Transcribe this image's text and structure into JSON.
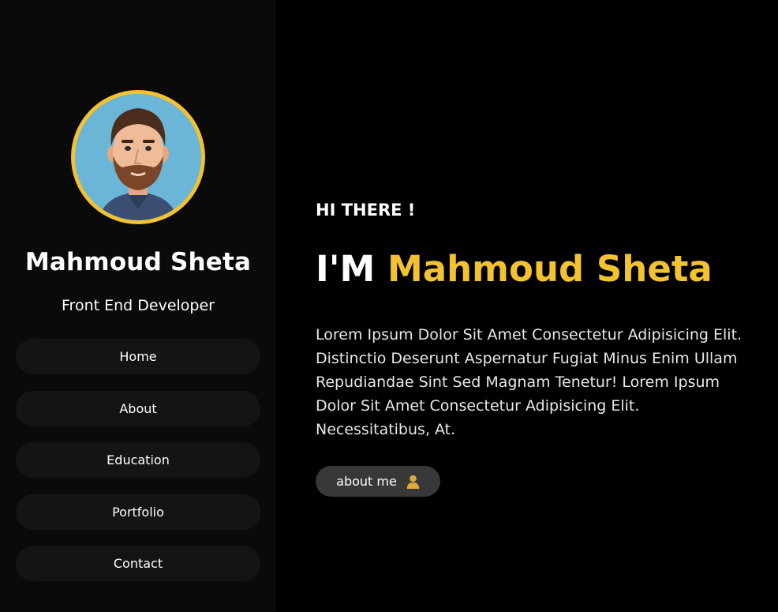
{
  "profile": {
    "name": "Mahmoud Sheta",
    "role": "Front End Developer"
  },
  "nav": {
    "items": [
      {
        "label": "Home"
      },
      {
        "label": "About"
      },
      {
        "label": "Education"
      },
      {
        "label": "Portfolio"
      },
      {
        "label": "Contact"
      }
    ]
  },
  "hero": {
    "greeting": "HI THERE !",
    "headline_prefix": "I'M",
    "headline_name": "Mahmoud Sheta",
    "bio": "Lorem Ipsum Dolor Sit Amet Consectetur Adipisicing Elit. Distinctio Deserunt Aspernatur Fugiat Minus Enim Ullam Repudiandae Sint Sed Magnam Tenetur! Lorem Ipsum Dolor Sit Amet Consectetur Adipisicing Elit. Necessitatibus, At.",
    "button_label": "about me",
    "button_icon": "user-icon"
  },
  "colors": {
    "accent": "#f2c230",
    "background": "#000000",
    "sidebar": "#0a0a0a",
    "nav_pill": "#141414",
    "button": "#383838"
  }
}
